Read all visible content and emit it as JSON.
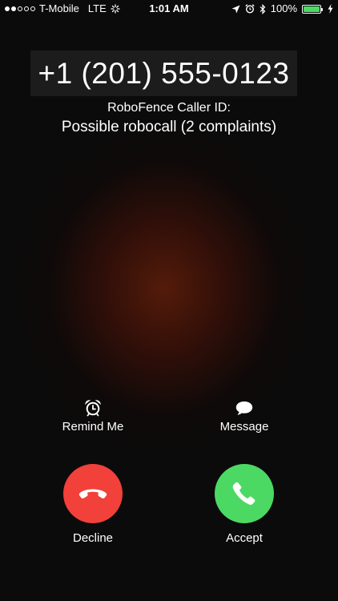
{
  "status_bar": {
    "signal_filled": 2,
    "signal_total": 5,
    "carrier": "T-Mobile",
    "network": "LTE",
    "time": "1:01 AM",
    "battery": "100%",
    "battery_color": "#4cd964"
  },
  "caller": {
    "number": "+1 (201) 555-0123",
    "id_label": "RoboFence Caller ID:",
    "id_status": "Possible robocall (2 complaints)"
  },
  "actions": {
    "remind_label": "Remind Me",
    "message_label": "Message",
    "decline_label": "Decline",
    "accept_label": "Accept"
  },
  "colors": {
    "decline": "#f2403a",
    "accept": "#4cd963"
  },
  "icons": {
    "activity": "activity-spinner-icon",
    "location": "location-arrow-icon",
    "alarm": "alarm-clock-icon",
    "bluetooth": "bluetooth-icon",
    "charging": "charging-bolt-icon",
    "remind": "alarm-clock-icon",
    "message": "speech-bubble-icon",
    "decline": "phone-hangup-icon",
    "accept": "phone-icon"
  }
}
